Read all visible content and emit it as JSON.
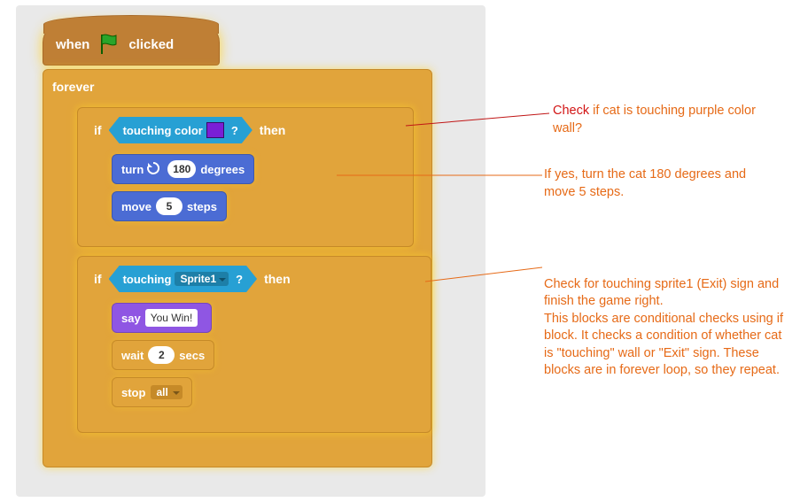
{
  "hat": {
    "when": "when",
    "clicked": "clicked"
  },
  "ctrl": {
    "forever": "forever",
    "if": "if",
    "then": "then",
    "stop": "stop",
    "stop_opt": "all",
    "wait": "wait",
    "secs": "secs"
  },
  "sensing": {
    "touching_color": "touching color",
    "touching": "touching",
    "sprite": "Sprite1",
    "q": "?"
  },
  "motion": {
    "turn": "turn",
    "degrees": "degrees",
    "turn_val": "180",
    "move": "move",
    "move_val": "5",
    "steps": "steps"
  },
  "looks": {
    "say": "say",
    "say_text": "You Win!"
  },
  "vals": {
    "wait_secs": "2"
  },
  "anno1": {
    "a": "Check",
    "b": " if cat is touching purple color wall?"
  },
  "anno2": "If yes, turn the cat 180 degrees and move 5 steps.",
  "anno3": "Check for touching sprite1 (Exit) sign and finish the game right.\nThis blocks are conditional checks using if block. It checks a condition of whether cat is \"touching\" wall or \"Exit\" sign. These blocks are in forever loop, so they repeat."
}
